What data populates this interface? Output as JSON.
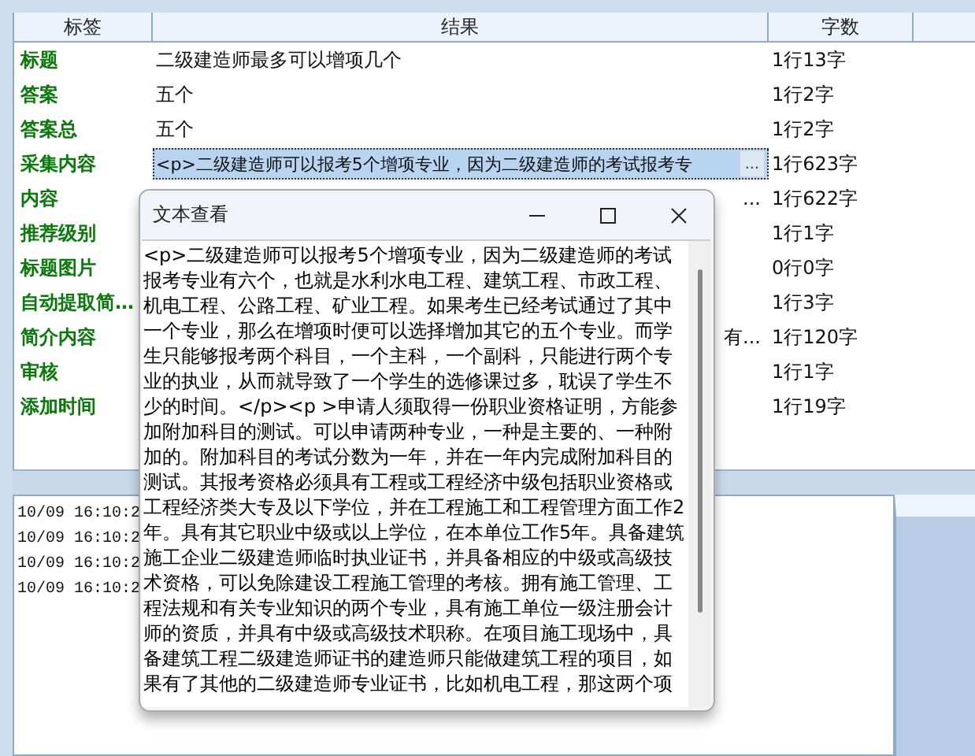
{
  "table": {
    "columns": [
      "标签",
      "结果",
      "字数"
    ],
    "rows": [
      {
        "label": "标题",
        "result": "二级建造师最多可以增项几个",
        "count": "1行13字",
        "selected": false
      },
      {
        "label": "答案",
        "result": "五个",
        "count": "1行2字",
        "selected": false
      },
      {
        "label": "答案总",
        "result": "五个",
        "count": "1行2字",
        "selected": false
      },
      {
        "label": "采集内容",
        "result": "<p>二级建造师可以报考5个增项专业，因为二级建造师的考试报考专",
        "count": "1行623字",
        "selected": true,
        "edit_button": "..."
      },
      {
        "label": "内容",
        "result": "...",
        "kind": "partial",
        "count": "1行622字",
        "selected": false
      },
      {
        "label": "推荐级别",
        "count": "1行1字",
        "selected": false
      },
      {
        "label": "标题图片",
        "count": "0行0字",
        "selected": false
      },
      {
        "label": "自动提取简…",
        "count": "1行3字",
        "selected": false
      },
      {
        "label": "简介内容",
        "result": "有...",
        "kind": "partial",
        "count": "1行120字",
        "selected": false
      },
      {
        "label": "审核",
        "count": "1行1字",
        "selected": false
      },
      {
        "label": "添加时间",
        "count": "1行19字",
        "selected": false
      }
    ]
  },
  "log": [
    "10/09 16:10:2",
    "10/09 16:10:2",
    "10/09 16:10:2",
    "10/09 16:10:2"
  ],
  "dialog": {
    "title": "文本查看",
    "text": "<p>二级建造师可以报考5个增项专业，因为二级建造师的考试报考专业有六个，也就是水利水电工程、建筑工程、市政工程、机电工程、公路工程、矿业工程。如果考生已经考试通过了其中一个专业，那么在增项时便可以选择增加其它的五个专业。而学生只能够报考两个科目，一个主科，一个副科，只能进行两个专业的执业，从而就导致了一个学生的选修课过多，耽误了学生不少的时间。</p><p >申请人须取得一份职业资格证明，方能参加附加科目的测试。可以申请两种专业，一种是主要的、一种附加的。附加科目的考试分数为一年，并在一年内完成附加科目的测试。其报考资格必须具有工程或工程经济中级包括职业资格或工程经济类大专及以下学位，并在工程施工和工程管理方面工作2年。具有其它职业中级或以上学位，在本单位工作5年。具备建筑施工企业二级建造师临时执业证书，并具备相应的中级或高级技术资格，可以免除建设工程施工管理的考核。拥有施工管理、工程法规和有关专业知识的两个专业，具有施工单位一级注册会计师的资质，并具有中级或高级技术职称。在项目施工现场中，具备建筑工程二级建造师证书的建造师只能做建筑工程的项目，如果有了其他的二级建造师专业证书，比如机电工程，那这两个项"
  }
}
